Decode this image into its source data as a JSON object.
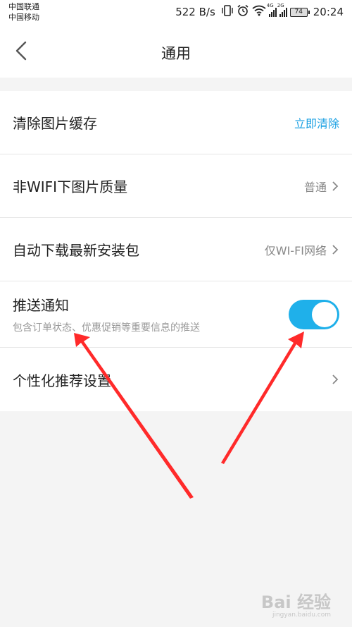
{
  "status_bar": {
    "carrier_1": "中国联通",
    "carrier_2": "中国移动",
    "speed": "522 B/s",
    "net_1": "4G",
    "net_2": "2G",
    "battery": "74",
    "time": "20:24"
  },
  "nav": {
    "title": "通用"
  },
  "settings": {
    "clear_cache": {
      "label": "清除图片缓存",
      "action": "立即清除"
    },
    "image_quality": {
      "label": "非WIFI下图片质量",
      "value": "普通"
    },
    "auto_download": {
      "label": "自动下载最新安装包",
      "value": "仅WI-FI网络"
    },
    "push": {
      "label": "推送通知",
      "description": "包含订单状态、优惠促销等重要信息的推送",
      "enabled": true
    },
    "personalized": {
      "label": "个性化推荐设置"
    }
  },
  "colors": {
    "accent": "#1da1e3",
    "toggle_on": "#1fb0ea",
    "arrow": "#ff2a2a"
  },
  "watermark": {
    "brand": "Bai 经验",
    "url": "jingyan.baidu.com"
  }
}
